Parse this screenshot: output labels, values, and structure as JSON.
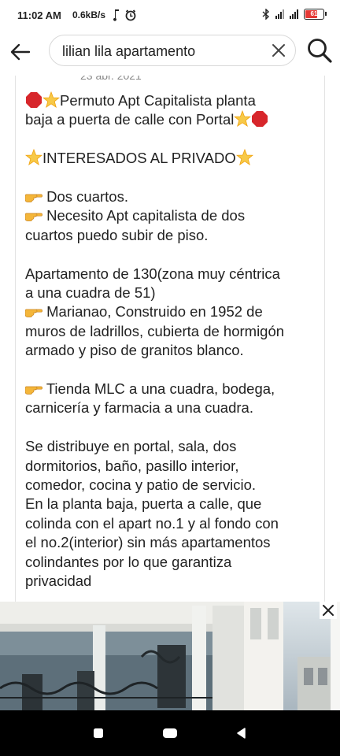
{
  "status": {
    "time": "11:02 AM",
    "speed": "0.6kB/s",
    "battery": "61"
  },
  "search": {
    "query": "lilian lila apartamento"
  },
  "post": {
    "date": "23 abr. 2021",
    "line1": "Permuto Apt Capitalista planta",
    "line2": "baja a puerta de calle con Portal",
    "interested": "INTERESADOS AL PRIVADO",
    "rooms": "Dos cuartos.",
    "need1": "Necesito Apt capitalista de dos",
    "need2": "cuartos puedo subir de piso.",
    "apt1": "Apartamento de  130(zona muy céntrica",
    "apt2": "a una cuadra de 51)",
    "mar1": "Marianao, Construido en 1952 de",
    "mar2": "muros de ladrillos, cubierta de hormigón",
    "mar3": "armado y piso de granitos blanco.",
    "store1": "Tienda MLC a una cuadra, bodega,",
    "store2": "carnicería y farmacia a una cuadra.",
    "dist1": "Se distribuye en portal, sala, dos",
    "dist2": "dormitorios, baño, pasillo interior,",
    "dist3": "comedor, cocina y patio de servicio.",
    "dist4": "En la planta baja, puerta a calle, que",
    "dist5": "colinda con el apart no.1 y al fondo con",
    "dist6": "el no.2(interior) sin más apartamentos",
    "dist7": "colindantes por lo que garantiza",
    "dist8": "privacidad"
  },
  "icons": {
    "back": "arrow-left-icon",
    "clear": "close-icon",
    "search": "search-icon",
    "stop": "red-stop-icon",
    "star": "glowing-star-icon",
    "hand": "pointing-hand-icon"
  },
  "colors": {
    "stop_red": "#d7262b",
    "star_yellow": "#f7c948",
    "hand_yellow": "#f4b63a"
  }
}
